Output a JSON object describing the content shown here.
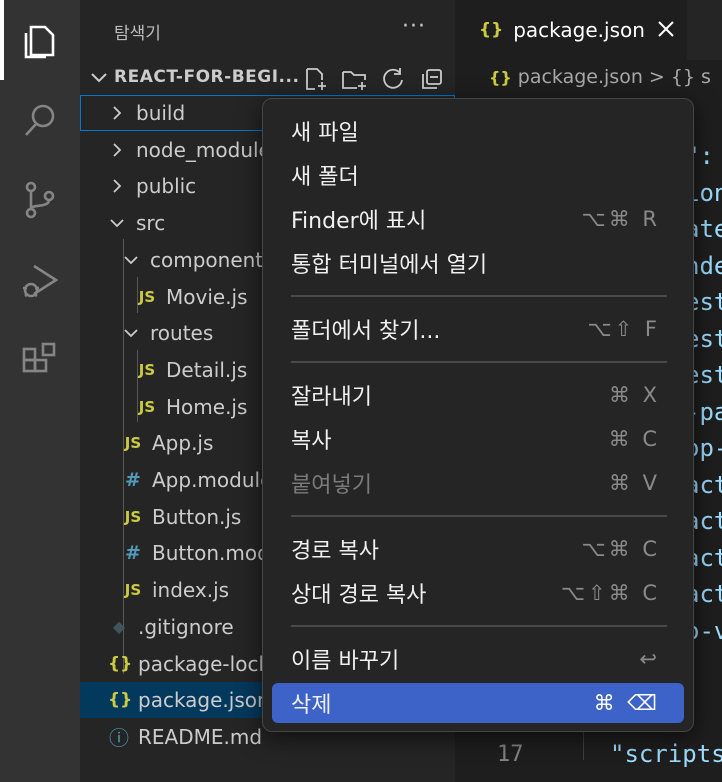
{
  "activity": [
    {
      "name": "explorer-icon",
      "active": true
    },
    {
      "name": "search-icon",
      "active": false
    },
    {
      "name": "source-control-icon",
      "active": false
    },
    {
      "name": "run-debug-icon",
      "active": false
    },
    {
      "name": "extensions-icon",
      "active": false
    }
  ],
  "sidebar": {
    "title": "탐색기",
    "more": "···",
    "project": "REACT-FOR-BEGI...",
    "project_actions": [
      "new-file-icon",
      "new-folder-icon",
      "refresh-icon",
      "collapse-all-icon"
    ],
    "items": [
      {
        "label": "build",
        "type": "folder",
        "expanded": false,
        "indent": 0
      },
      {
        "label": "node_modules",
        "type": "folder",
        "expanded": false,
        "indent": 0
      },
      {
        "label": "public",
        "type": "folder",
        "expanded": false,
        "indent": 0
      },
      {
        "label": "src",
        "type": "folder",
        "expanded": true,
        "indent": 0
      },
      {
        "label": "components",
        "type": "folder",
        "expanded": true,
        "indent": 1
      },
      {
        "label": "Movie.js",
        "type": "js",
        "indent": 2
      },
      {
        "label": "routes",
        "type": "folder",
        "expanded": true,
        "indent": 1
      },
      {
        "label": "Detail.js",
        "type": "js",
        "indent": 2
      },
      {
        "label": "Home.js",
        "type": "js",
        "indent": 2
      },
      {
        "label": "App.js",
        "type": "js",
        "indent": 1
      },
      {
        "label": "App.module.css",
        "type": "css",
        "indent": 1
      },
      {
        "label": "Button.js",
        "type": "js",
        "indent": 1
      },
      {
        "label": "Button.module.css",
        "type": "css",
        "indent": 1
      },
      {
        "label": "index.js",
        "type": "js",
        "indent": 1
      },
      {
        "label": ".gitignore",
        "type": "git",
        "indent": 0
      },
      {
        "label": "package-lock.json",
        "type": "json",
        "indent": 0
      },
      {
        "label": "package.json",
        "type": "json",
        "indent": 0,
        "selected": true
      },
      {
        "label": "README.md",
        "type": "info",
        "indent": 0
      }
    ]
  },
  "editor": {
    "tab_label": "package.json",
    "tab_icon": "{}",
    "breadcrumb_file": "package.json",
    "breadcrumb_sep": ">",
    "breadcrumb_next": "{} s",
    "code_fragments": [
      "\": ",
      "ion",
      "ate",
      "nde",
      "est",
      "est",
      "est",
      "-pa",
      "op-",
      "act",
      "act",
      "act",
      "act",
      "o-v"
    ],
    "line_number": "17",
    "line_text": "\"scripts"
  },
  "context_menu": {
    "items": [
      {
        "label": "새 파일",
        "shortcut": ""
      },
      {
        "label": "새 폴더",
        "shortcut": ""
      },
      {
        "label": "Finder에 표시",
        "shortcut": "⌥⌘ R"
      },
      {
        "label": "통합 터미널에서 열기",
        "shortcut": ""
      },
      {
        "label": "폴더에서 찾기...",
        "shortcut": "⌥⇧ F"
      },
      {
        "label": "잘라내기",
        "shortcut": "⌘ X"
      },
      {
        "label": "복사",
        "shortcut": "⌘ C"
      },
      {
        "label": "붙여넣기",
        "shortcut": "⌘ V",
        "disabled": true
      },
      {
        "label": "경로 복사",
        "shortcut": "⌥⌘ C"
      },
      {
        "label": "상대 경로 복사",
        "shortcut": "⌥⇧⌘ C"
      },
      {
        "label": "이름 바꾸기",
        "shortcut": "↩"
      },
      {
        "label": "삭제",
        "shortcut": "⌘ ⌫",
        "highlighted": true
      }
    ]
  },
  "colors": {
    "accent": "#3d63c9",
    "selection": "#04395e",
    "js": "#cbcb41",
    "css": "#519aba"
  }
}
